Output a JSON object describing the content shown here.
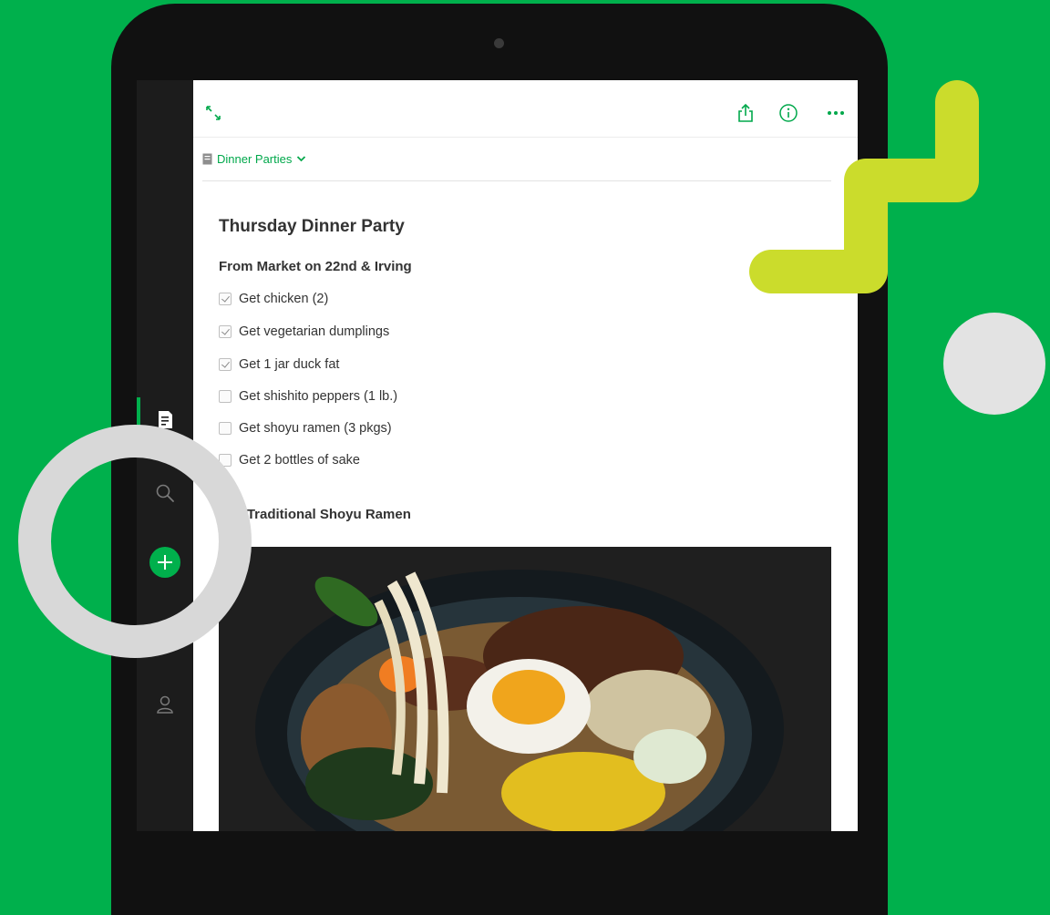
{
  "colors": {
    "background": "#00b04c",
    "accent": "#00a84b",
    "zigzag": "#cbdc2c",
    "ring": "#d8d8d8"
  },
  "sidebar": {
    "items": [
      {
        "icon": "note-icon",
        "active": true
      },
      {
        "icon": "search-icon",
        "active": false
      },
      {
        "icon": "add-note-icon",
        "active": false
      },
      {
        "icon": "account-icon",
        "active": false
      }
    ]
  },
  "toolbar": {
    "expand_icon": "expand-icon",
    "share_icon": "share-icon",
    "info_icon": "info-icon",
    "more_icon": "more-icon"
  },
  "notebook": {
    "name": "Dinner Parties",
    "icon": "notebook-icon",
    "chevron": "chevron-down-icon"
  },
  "note": {
    "title": "Thursday Dinner Party",
    "section": "From Market on 22nd & Irving",
    "todos": [
      {
        "label": "Get chicken (2)",
        "checked": true
      },
      {
        "label": "Get vegetarian dumplings",
        "checked": true
      },
      {
        "label": "Get 1 jar duck fat",
        "checked": true
      },
      {
        "label": "Get shishito peppers (1 lb.)",
        "checked": false
      },
      {
        "label": "Get shoyu ramen (3 pkgs)",
        "checked": false
      },
      {
        "label": "Get 2 bottles of sake",
        "checked": false
      }
    ],
    "recipe_heading": "ipe: Traditional  Shoyu Ramen",
    "image": "ramen-photo"
  }
}
